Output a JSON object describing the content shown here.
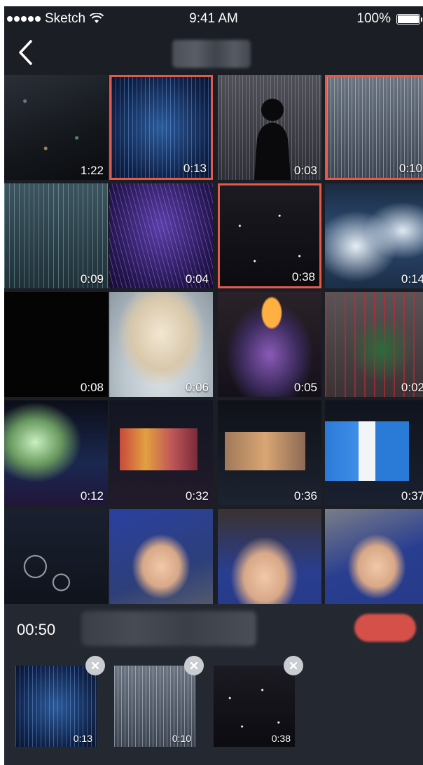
{
  "status_bar": {
    "carrier": "Sketch",
    "time": "9:41 AM",
    "battery": "100%"
  },
  "nav": {
    "back_icon": "chevron-left-icon"
  },
  "grid": {
    "tiles": [
      {
        "duration": "1:22",
        "selected": false
      },
      {
        "duration": "0:13",
        "selected": true
      },
      {
        "duration": "0:03",
        "selected": false
      },
      {
        "duration": "0:10",
        "selected": true
      },
      {
        "duration": "0:09",
        "selected": false
      },
      {
        "duration": "0:04",
        "selected": false
      },
      {
        "duration": "0:38",
        "selected": true
      },
      {
        "duration": "0:14",
        "selected": false
      },
      {
        "duration": "0:08",
        "selected": false
      },
      {
        "duration": "0:06",
        "selected": false
      },
      {
        "duration": "0:05",
        "selected": false
      },
      {
        "duration": "0:02",
        "selected": false
      },
      {
        "duration": "0:12",
        "selected": false
      },
      {
        "duration": "0:32",
        "selected": false
      },
      {
        "duration": "0:36",
        "selected": false
      },
      {
        "duration": "0:37",
        "selected": false
      },
      {
        "duration": "",
        "selected": false
      },
      {
        "duration": "",
        "selected": false
      },
      {
        "duration": "",
        "selected": false
      },
      {
        "duration": "",
        "selected": false
      }
    ],
    "selected_border_color": "#e5594b"
  },
  "bottom": {
    "total_duration": "00:50",
    "confirm_color": "#d6504a",
    "selected_items": [
      {
        "duration": "0:13"
      },
      {
        "duration": "0:10"
      },
      {
        "duration": "0:38"
      }
    ],
    "remove_icon": "close-icon"
  }
}
